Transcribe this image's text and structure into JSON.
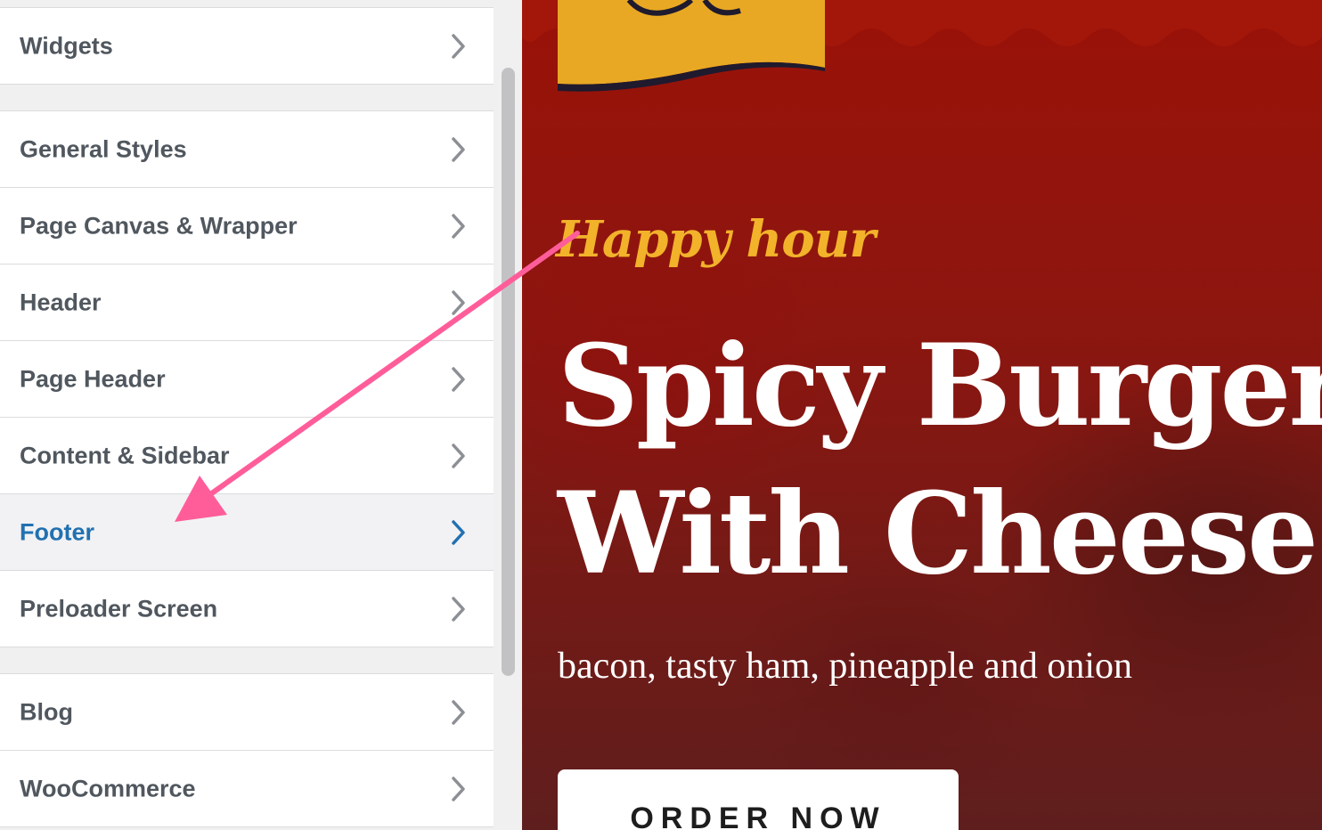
{
  "sidebar": {
    "items": [
      {
        "label": "Widgets"
      },
      {
        "label": "General Styles"
      },
      {
        "label": "Page Canvas & Wrapper"
      },
      {
        "label": "Header"
      },
      {
        "label": "Page Header"
      },
      {
        "label": "Content & Sidebar"
      },
      {
        "label": "Footer",
        "active": true
      },
      {
        "label": "Preloader Screen"
      },
      {
        "label": "Blog"
      },
      {
        "label": "WooCommerce"
      }
    ],
    "icon": "chevron-right-icon",
    "active_color": "#2271b1",
    "text_color": "#50575e"
  },
  "preview": {
    "kicker": "Happy hour",
    "headline_line1": "Spicy Burger",
    "headline_line2": "With Cheese",
    "subline": "bacon, tasty ham, pineapple and onion",
    "button_label": "ORDER NOW",
    "accent_color": "#f2b22a",
    "background_color": "#8c1610"
  },
  "annotation": {
    "type": "arrow",
    "color": "#ff5d9a",
    "points_to": "Footer"
  }
}
